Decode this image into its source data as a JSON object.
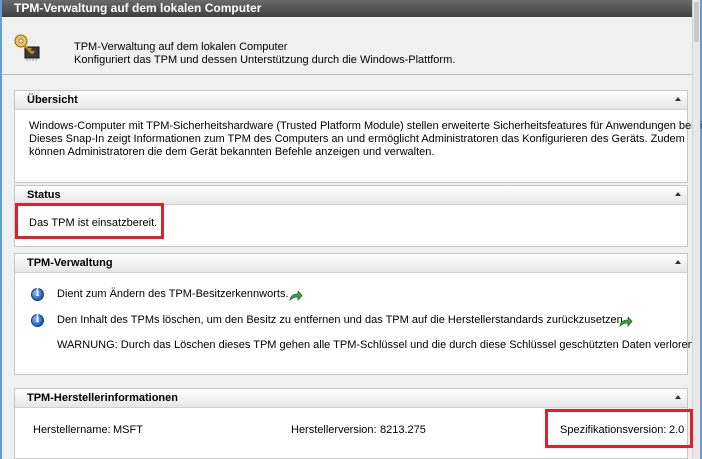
{
  "window": {
    "title": "TPM-Verwaltung auf dem lokalen Computer"
  },
  "header": {
    "icon": "key-chip-icon",
    "title": "TPM-Verwaltung auf dem lokalen Computer",
    "description": "Konfiguriert das TPM und dessen Unterstützung durch die Windows-Plattform."
  },
  "sections": {
    "overview": {
      "title": "Übersicht",
      "lines": [
        "Windows-Computer mit TPM-Sicherheitshardware (Trusted Platform Module) stellen erweiterte Sicherheitsfeatures für Anwendungen bereit.",
        "Dieses Snap-In zeigt Informationen zum TPM des Computers an und ermöglicht Administratoren das Konfigurieren des Geräts. Zudem",
        "können Administratoren die dem Gerät bekannten Befehle anzeigen und verwalten."
      ]
    },
    "status": {
      "title": "Status",
      "text": "Das TPM ist einsatzbereit."
    },
    "management": {
      "title": "TPM-Verwaltung",
      "items": [
        "Dient zum Ändern des TPM-Besitzerkennworts.",
        "Den Inhalt des TPMs löschen, um den Besitz zu entfernen und das TPM auf die Herstellerstandards zurückzusetzen."
      ],
      "warning": "WARNUNG: Durch das Löschen dieses TPM gehen alle TPM-Schlüssel und die durch diese Schlüssel geschützten Daten verloren."
    },
    "manufacturer": {
      "title": "TPM-Herstellerinformationen",
      "name_label": "Herstellername:",
      "name_value": "MSFT",
      "version_label": "Herstellerversion:",
      "version_value": "8213.275",
      "spec_label": "Spezifikationsversion:",
      "spec_value": "2.0"
    }
  },
  "colors": {
    "highlight_box": "#e0202a",
    "title_bar": "#4a4a4a",
    "window_border": "#5ea0d6"
  }
}
